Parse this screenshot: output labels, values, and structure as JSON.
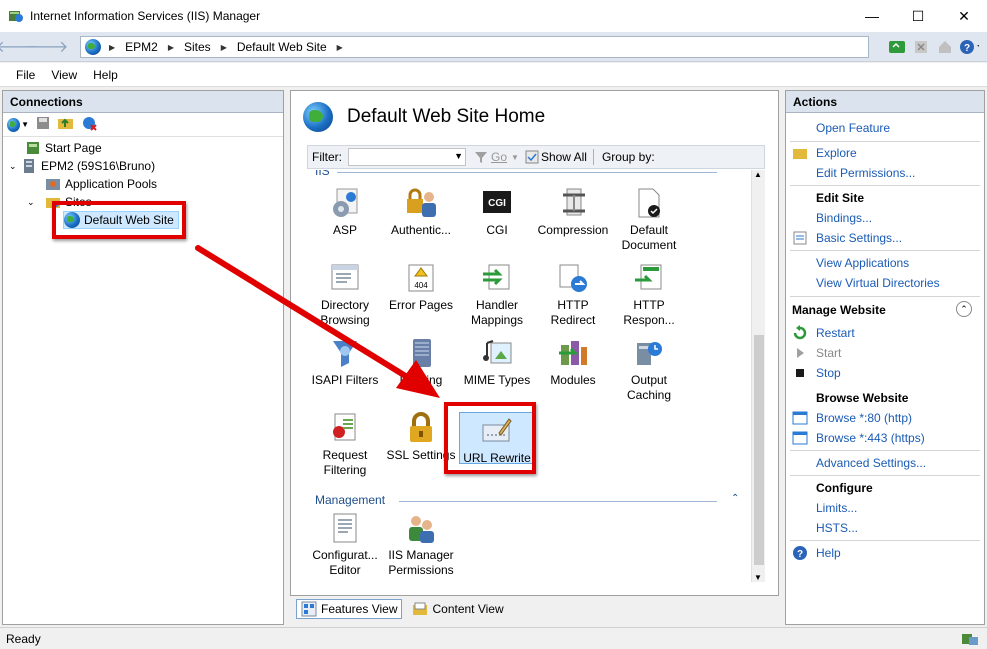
{
  "window": {
    "title": "Internet Information Services (IIS) Manager",
    "minimize": "—",
    "maximize": "☐",
    "close": "✕"
  },
  "address": {
    "crumbs": [
      "EPM2",
      "Sites",
      "Default Web Site"
    ]
  },
  "menu": {
    "file": "File",
    "view": "View",
    "help": "Help"
  },
  "connections": {
    "header": "Connections",
    "tree": {
      "start_page": "Start Page",
      "server": "EPM2 (59S16\\Bruno)",
      "app_pools": "Application Pools",
      "sites": "Sites",
      "default_site": "Default Web Site"
    }
  },
  "center": {
    "title": "Default Web Site Home",
    "filter_label": "Filter:",
    "go_label": "Go",
    "show_all": "Show All",
    "group_by": "Group by:",
    "sections": {
      "iis": "IIS",
      "management": "Management"
    },
    "features": {
      "asp": "ASP",
      "authentication": "Authentic...",
      "cgi": "CGI",
      "compression": "Compression",
      "default_document": "Default Document",
      "directory_browsing": "Directory Browsing",
      "error_pages": "Error Pages",
      "handler_mappings": "Handler Mappings",
      "http_redirect": "HTTP Redirect",
      "http_response": "HTTP Respon...",
      "isapi_filters": "ISAPI Filters",
      "logging": "Logging",
      "mime_types": "MIME Types",
      "modules": "Modules",
      "output_caching": "Output Caching",
      "request_filtering": "Request Filtering",
      "ssl_settings": "SSL Settings",
      "url_rewrite": "URL Rewrite",
      "config_editor": "Configurat... Editor",
      "iis_mgr_perms": "IIS Manager Permissions"
    },
    "cgi_badge": "CGI",
    "error_badge": "404",
    "features_view": "Features View",
    "content_view": "Content View"
  },
  "actions": {
    "header": "Actions",
    "open_feature": "Open Feature",
    "explore": "Explore",
    "edit_permissions": "Edit Permissions...",
    "edit_site": "Edit Site",
    "bindings": "Bindings...",
    "basic_settings": "Basic Settings...",
    "view_applications": "View Applications",
    "view_virtual_dirs": "View Virtual Directories",
    "manage_website": "Manage Website",
    "restart": "Restart",
    "start": "Start",
    "stop": "Stop",
    "browse_website": "Browse Website",
    "browse_80": "Browse *:80 (http)",
    "browse_443": "Browse *:443 (https)",
    "advanced_settings": "Advanced Settings...",
    "configure": "Configure",
    "limits": "Limits...",
    "hsts": "HSTS...",
    "help": "Help"
  },
  "status": {
    "text": "Ready"
  },
  "colors": {
    "annotation": "#e00000",
    "link": "#1a5bb5",
    "selection": "#cde8ff"
  }
}
